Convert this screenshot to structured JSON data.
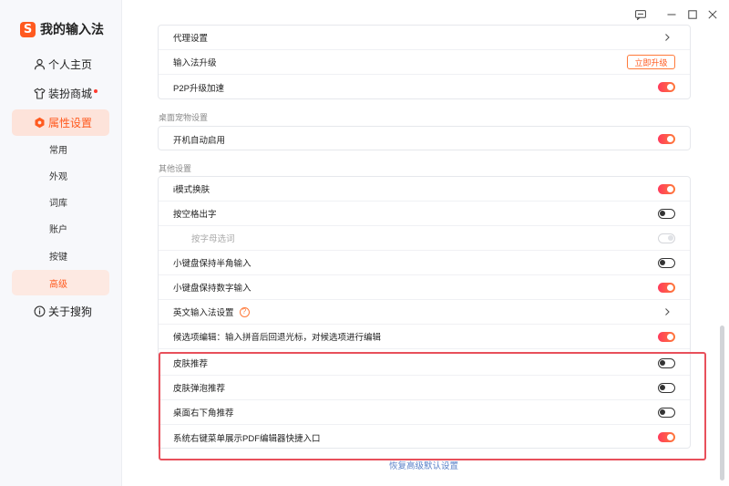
{
  "app": {
    "title": "我的输入法",
    "logo_glyph": "S",
    "brand_color": "#ff5a1f"
  },
  "window_controls": [
    {
      "name": "feedback-icon"
    },
    {
      "name": "minimize-icon"
    },
    {
      "name": "maximize-icon"
    },
    {
      "name": "close-icon"
    }
  ],
  "sidebar": {
    "items": [
      {
        "label": "个人主页",
        "icon": "user-icon"
      },
      {
        "label": "装扮商城",
        "icon": "shirt-icon",
        "badge_dot": true
      },
      {
        "label": "属性设置",
        "icon": "hexagon-settings-icon",
        "active": true
      },
      {
        "label": "关于搜狗",
        "icon": "info-icon"
      }
    ],
    "subitems": [
      {
        "label": "常用"
      },
      {
        "label": "外观"
      },
      {
        "label": "词库"
      },
      {
        "label": "账户"
      },
      {
        "label": "按键"
      },
      {
        "label": "高级",
        "active": true
      }
    ]
  },
  "main": {
    "card1": {
      "rows": [
        {
          "label": "代理设置",
          "control": "chevron"
        },
        {
          "label": "输入法升级",
          "control": "button",
          "button_label": "立即升级"
        },
        {
          "label": "P2P升级加速",
          "control": "toggle",
          "state": "on"
        }
      ]
    },
    "section_desktop_pet": {
      "label": "桌面宠物设置",
      "rows": [
        {
          "label": "开机自动启用",
          "control": "toggle",
          "state": "on"
        }
      ]
    },
    "section_other": {
      "label": "其他设置",
      "rows": [
        {
          "label": "i模式换肤",
          "control": "toggle",
          "state": "on"
        },
        {
          "label": "按空格出字",
          "control": "toggle",
          "state": "off"
        },
        {
          "label": "按字母选词",
          "control": "toggle",
          "state": "disabled"
        },
        {
          "label": "小键盘保持半角输入",
          "control": "toggle",
          "state": "off"
        },
        {
          "label": "小键盘保持数字输入",
          "control": "toggle",
          "state": "on"
        },
        {
          "label": "英文输入法设置",
          "control": "chevron",
          "help": "?"
        },
        {
          "label": "候选项编辑：输入拼音后回退光标，对候选项进行编辑",
          "control": "toggle",
          "state": "on"
        },
        {
          "label": "皮肤推荐",
          "control": "toggle",
          "state": "off"
        },
        {
          "label": "皮肤弹泡推荐",
          "control": "toggle",
          "state": "off"
        },
        {
          "label": "桌面右下角推荐",
          "control": "toggle",
          "state": "off"
        },
        {
          "label": "系统右键菜单展示PDF编辑器快捷入口",
          "control": "toggle",
          "state": "on"
        }
      ]
    },
    "restore_link": "恢复高级默认设置",
    "highlight_color": "#e8505b",
    "toggle_gradient": [
      "#ff3b5c",
      "#ff7a3a"
    ]
  }
}
